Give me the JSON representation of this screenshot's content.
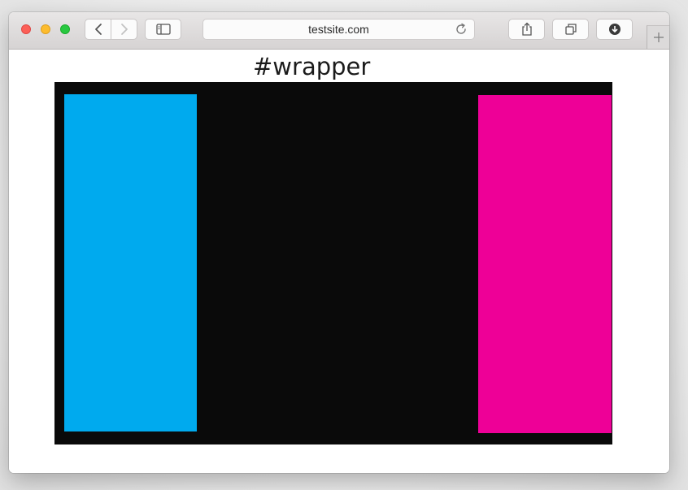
{
  "browser": {
    "url": "testsite.com",
    "icons": {
      "back": "chevron-left-icon",
      "forward": "chevron-right-icon",
      "sidebar": "sidebar-icon",
      "reload": "reload-icon",
      "share": "share-icon",
      "tabs": "tabs-icon",
      "download": "download-icon",
      "new_tab": "plus-icon"
    },
    "traffic_light_colors": {
      "close": "#fc5f57",
      "minimize": "#fdbc2e",
      "maximize": "#28c840"
    }
  },
  "page": {
    "heading": "#wrapper",
    "wrapper_color": "#0a0a0a",
    "left_column_color": "#00aaee",
    "right_column_color": "#ee0097"
  }
}
